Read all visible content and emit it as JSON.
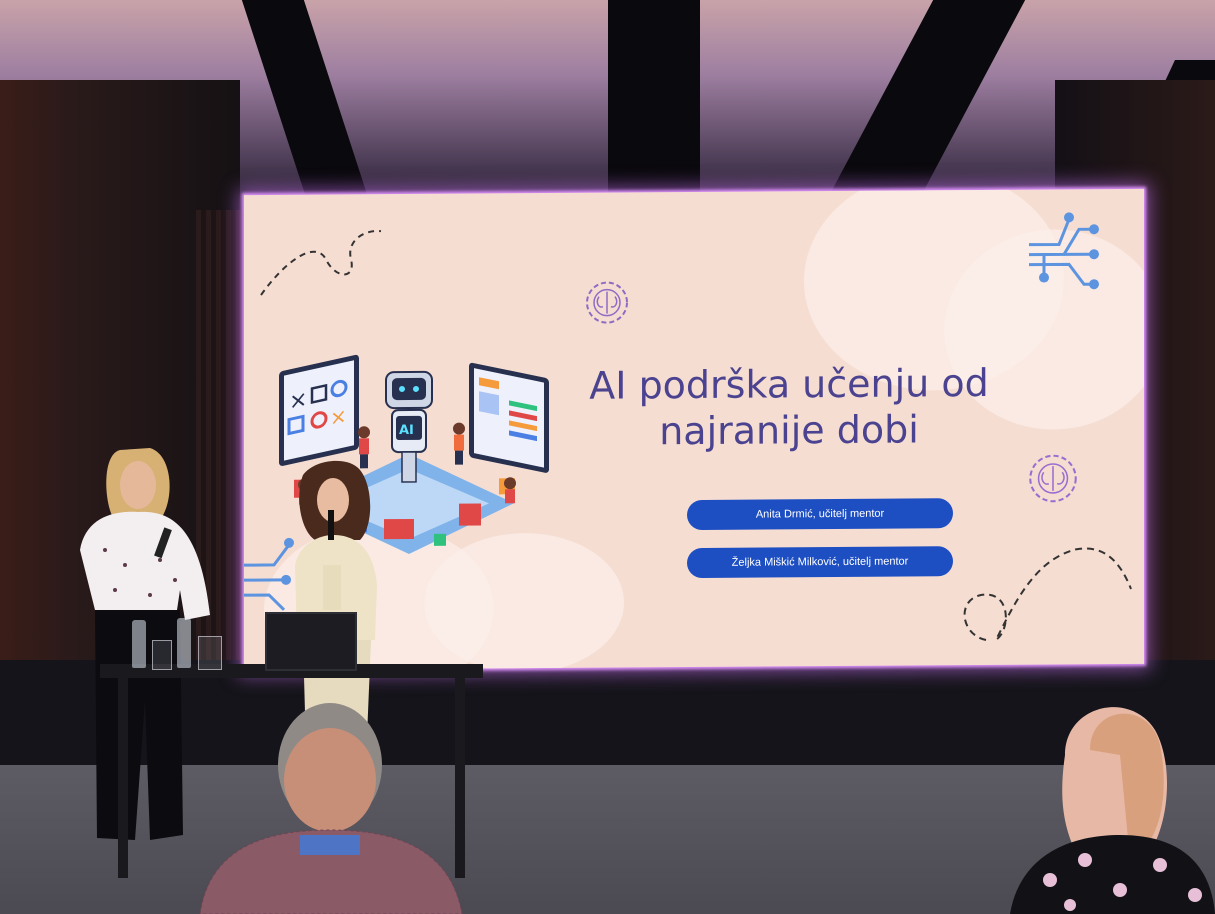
{
  "photo": {
    "description_kind": "conference stage photo",
    "slide": {
      "title": "AI podrška učenju od najranije dobi",
      "presenters": [
        "Anita Drmić, učitelj mentor",
        "Željka Miškić Milković, učitelj mentor"
      ],
      "illustration_text": "AI",
      "colors": {
        "background": "#f6ddd2",
        "title": "#4b4390",
        "pill": "#1e4fc2",
        "glow": "#d98cff",
        "circuit": "#6a9ee0"
      }
    }
  }
}
